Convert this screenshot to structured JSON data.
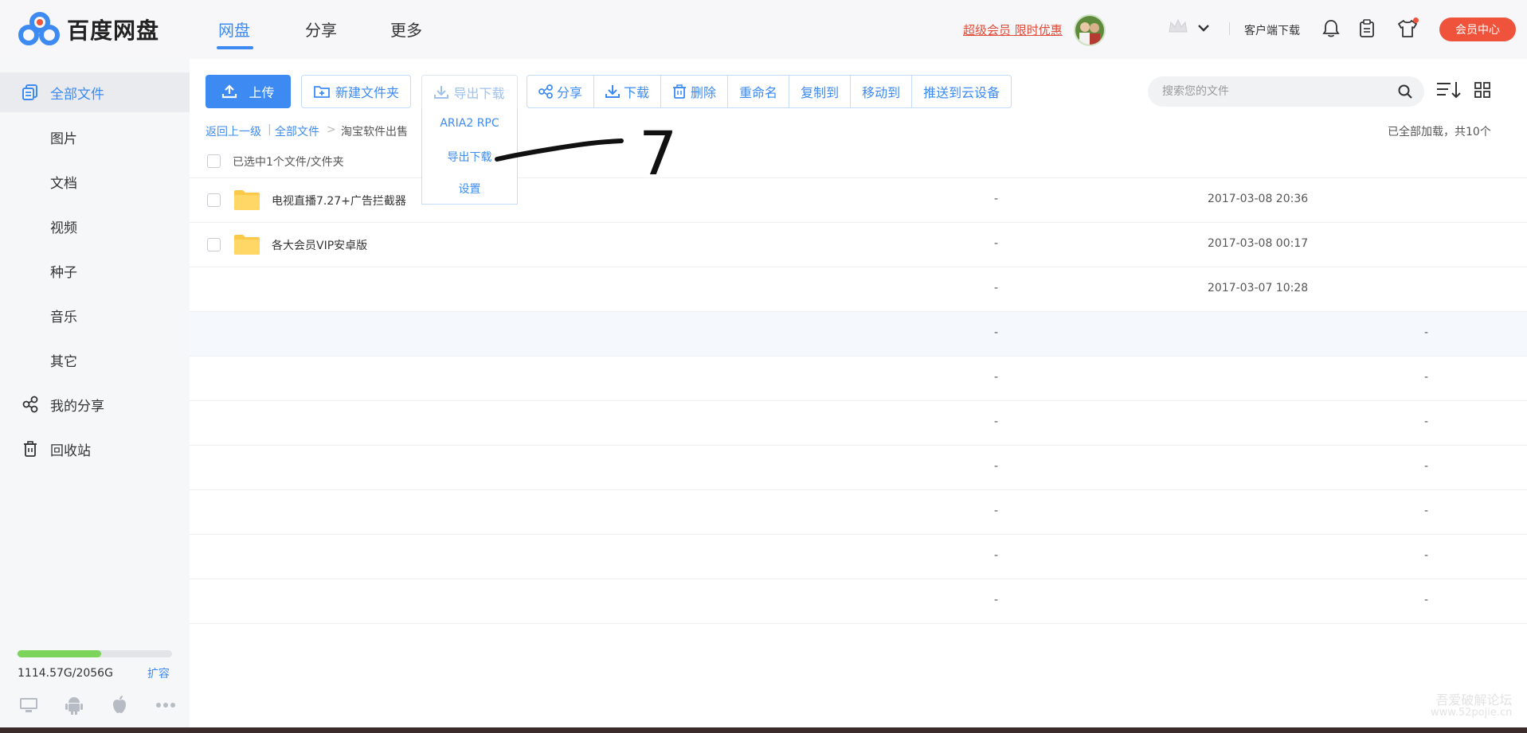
{
  "app": {
    "name": "百度网盘",
    "colors": {
      "accent": "#3d8bf2",
      "danger": "#f0533b",
      "quota": "#7cd55a"
    }
  },
  "header": {
    "tabs": [
      {
        "label": "网盘",
        "active": true
      },
      {
        "label": "分享",
        "active": false
      },
      {
        "label": "更多",
        "active": false
      }
    ],
    "promo": "超级会员 限时优惠",
    "client_download": "客户端下载",
    "vip_center": "会员中心",
    "icons": [
      "crown-icon",
      "chevron-down-icon",
      "bell-icon",
      "clipboard-icon",
      "shirt-icon"
    ]
  },
  "sidebar": {
    "items": [
      {
        "label": "全部文件",
        "icon": "files-icon",
        "active": true
      },
      {
        "label": "图片"
      },
      {
        "label": "文档"
      },
      {
        "label": "视频"
      },
      {
        "label": "种子"
      },
      {
        "label": "音乐"
      },
      {
        "label": "其它"
      },
      {
        "label": "我的分享",
        "icon": "share-icon"
      },
      {
        "label": "回收站",
        "icon": "trash-icon"
      }
    ],
    "quota": {
      "text": "1114.57G/2056G",
      "used_fraction": 0.542
    },
    "expand": "扩容",
    "devices": [
      "desktop-icon",
      "android-icon",
      "apple-icon",
      "more-icon"
    ]
  },
  "toolbar": {
    "upload": "上传",
    "new_folder": "新建文件夹",
    "export_download": "导出下载",
    "group": [
      "分享",
      "下载",
      "删除",
      "重命名",
      "复制到",
      "移动到",
      "推送到云设备"
    ]
  },
  "search": {
    "placeholder": "搜索您的文件"
  },
  "dropdown": {
    "items": [
      "ARIA2 RPC",
      "导出下载",
      "设置"
    ]
  },
  "breadcrumb": {
    "back": "返回上一级",
    "root": "全部文件",
    "separator": ">",
    "current": "淘宝软件出售"
  },
  "loaded_info": "已全部加载，共10个",
  "selection": {
    "text": "已选中1个文件/文件夹"
  },
  "files": [
    {
      "name": "电视直播7.27+广告拦截器",
      "size": "-",
      "date": "2017-03-08 20:36",
      "folder": true
    },
    {
      "name": "各大会员VIP安卓版",
      "size": "-",
      "date": "2017-03-08 00:17",
      "folder": true
    },
    {
      "name": "",
      "size": "-",
      "date": "2017-03-07 10:28",
      "folder": false
    },
    {
      "name": "",
      "size": "-",
      "extra": "-"
    },
    {
      "name": "",
      "size": "-",
      "extra": "-"
    },
    {
      "name": "",
      "size": "-",
      "extra": "-"
    },
    {
      "name": "",
      "size": "-",
      "extra": "-"
    },
    {
      "name": "",
      "size": "-",
      "extra": "-"
    },
    {
      "name": "",
      "size": "-",
      "extra": "-"
    },
    {
      "name": "",
      "size": "-",
      "extra": "-"
    }
  ],
  "annotation": {
    "number": "7"
  },
  "watermark": {
    "line1": "吾爱破解论坛",
    "line2": "www.52pojie.cn"
  }
}
